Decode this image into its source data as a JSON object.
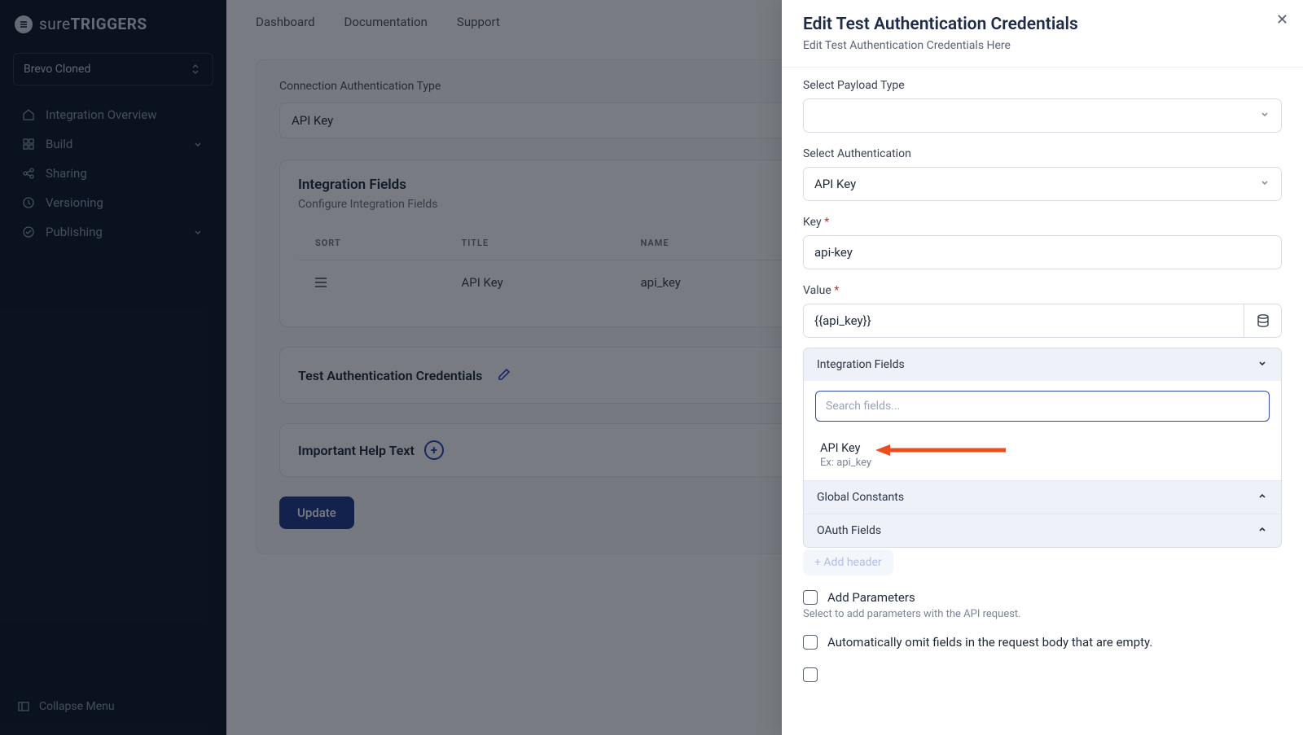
{
  "brand": {
    "prefix": "sure",
    "bold": "TRIGGERS"
  },
  "project_name": "Brevo Cloned",
  "sidebar": {
    "items": [
      {
        "label": "Integration Overview"
      },
      {
        "label": "Build"
      },
      {
        "label": "Sharing"
      },
      {
        "label": "Versioning"
      },
      {
        "label": "Publishing"
      }
    ],
    "collapse": "Collapse Menu"
  },
  "topnav": [
    "Dashboard",
    "Documentation",
    "Support"
  ],
  "main": {
    "conn_label": "Connection Authentication Type",
    "conn_value": "API Key",
    "fields_title": "Integration Fields",
    "fields_desc": "Configure Integration Fields",
    "table": {
      "headers": [
        "SORT",
        "TITLE",
        "NAME"
      ],
      "row": {
        "title": "API Key",
        "name": "api_key"
      }
    },
    "test_creds": "Test Authentication Credentials",
    "help_text": "Important Help Text",
    "update": "Update"
  },
  "drawer": {
    "title": "Edit Test Authentication Credentials",
    "subtitle": "Edit Test Authentication Credentials Here",
    "payload_label": "Select Payload Type",
    "auth_label": "Select Authentication",
    "auth_value": "API Key",
    "key_label": "Key",
    "key_value": "api-key",
    "value_label": "Value",
    "value_value": "{{api_key}}",
    "dd": {
      "section1": "Integration Fields",
      "search_placeholder": "Search fields...",
      "item_title": "API Key",
      "item_sub": "Ex: api_key",
      "section2": "Global Constants",
      "section3": "OAuth Fields"
    },
    "add_header": "+ Add header",
    "add_params": "Add Parameters",
    "params_hint": "Select to add parameters with the API request.",
    "omit_empty": "Automatically omit fields in the request body that are empty."
  }
}
